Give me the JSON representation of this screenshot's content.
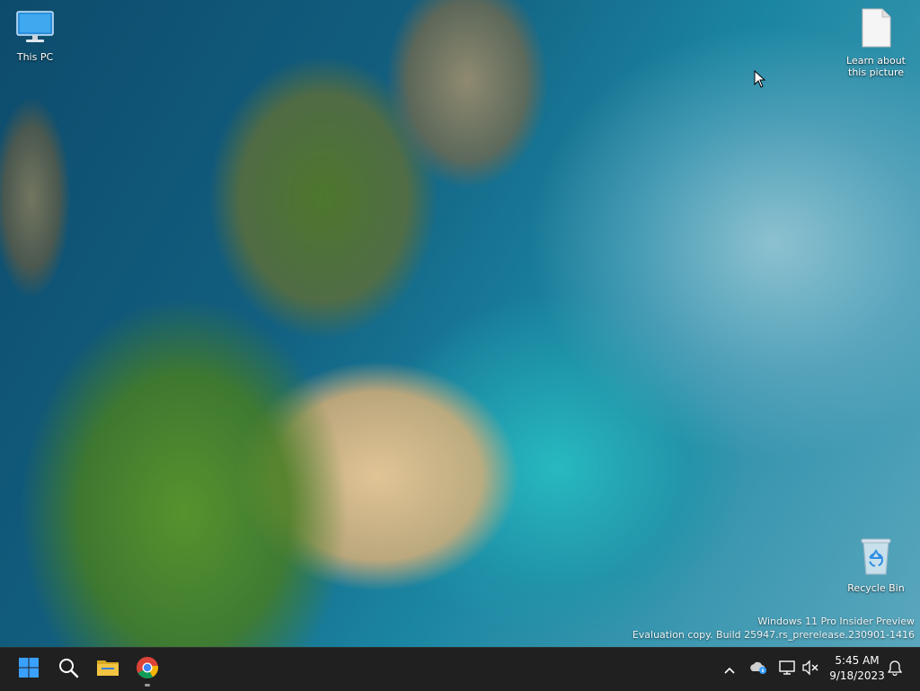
{
  "desktop": {
    "icons": [
      {
        "label": "This PC",
        "icon": "monitor-icon"
      },
      {
        "label": "Learn about\nthis picture",
        "icon": "document-icon"
      },
      {
        "label": "Recycle Bin",
        "icon": "recycle-bin-icon"
      }
    ],
    "watermark": {
      "line1": "Windows 11 Pro Insider Preview",
      "line2": "Evaluation copy. Build 25947.rs_prerelease.230901-1416"
    }
  },
  "taskbar": {
    "buttons": [
      {
        "name": "start",
        "icon": "windows-logo-icon"
      },
      {
        "name": "search",
        "icon": "search-icon"
      },
      {
        "name": "file-explorer",
        "icon": "folder-icon"
      },
      {
        "name": "chrome",
        "icon": "chrome-icon",
        "running": true
      }
    ],
    "tray": {
      "icons": [
        "chevron-up-icon",
        "onedrive-icon",
        "network-icon",
        "volume-muted-icon",
        "bell-icon"
      ],
      "time": "5:45 AM",
      "date": "9/18/2023"
    }
  },
  "colors": {
    "taskbar_bg": "#202020",
    "start_blue": "#3aa0ff",
    "folder_yellow": "#f4c542"
  }
}
